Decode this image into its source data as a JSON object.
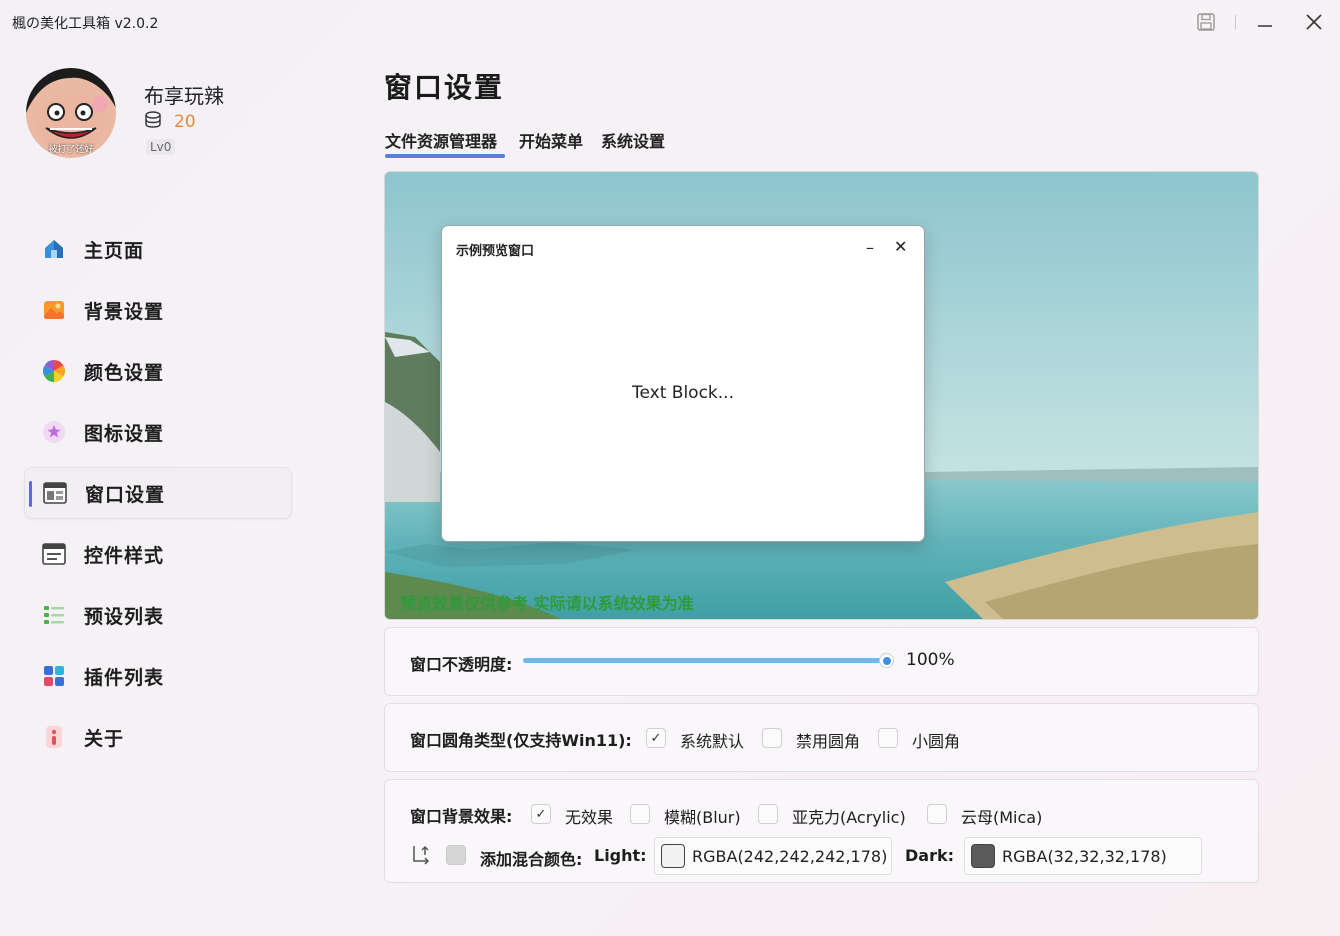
{
  "window": {
    "title": "楓の美化工具箱 v2.0.2"
  },
  "profile": {
    "name": "布享玩辣",
    "coins": "20",
    "level": "Lv0",
    "avatar_caption": "被打了还好"
  },
  "nav": [
    {
      "label": "主页面",
      "icon": "home-icon"
    },
    {
      "label": "背景设置",
      "icon": "picture-icon"
    },
    {
      "label": "颜色设置",
      "icon": "color-wheel-icon"
    },
    {
      "label": "图标设置",
      "icon": "star-icon"
    },
    {
      "label": "窗口设置",
      "icon": "window-icon",
      "active": true
    },
    {
      "label": "控件样式",
      "icon": "widget-icon"
    },
    {
      "label": "预设列表",
      "icon": "list-icon"
    },
    {
      "label": "插件列表",
      "icon": "apps-icon"
    },
    {
      "label": "关于",
      "icon": "info-icon"
    }
  ],
  "page": {
    "title": "窗口设置",
    "tabs": [
      "文件资源管理器",
      "开始菜单",
      "系统设置"
    ],
    "active_tab": 0
  },
  "preview": {
    "window_title": "示例预览窗口",
    "text_block": "Text Block...",
    "note": "预览效果仅供参考 实际请以系统效果为准"
  },
  "opacity": {
    "label": "窗口不透明度:",
    "value": 1.0,
    "value_text": "100%"
  },
  "corner": {
    "label": "窗口圆角类型(仅支持Win11):",
    "options": [
      {
        "label": "系统默认",
        "checked": true
      },
      {
        "label": "禁用圆角",
        "checked": false
      },
      {
        "label": "小圆角",
        "checked": false
      }
    ]
  },
  "backdrop": {
    "label": "窗口背景效果:",
    "options": [
      {
        "label": "无效果",
        "checked": true
      },
      {
        "label": "模糊(Blur)",
        "checked": false
      },
      {
        "label": "亚克力(Acrylic)",
        "checked": false
      },
      {
        "label": "云母(Mica)",
        "checked": false
      }
    ],
    "blend_label": "添加混合颜色:",
    "light_label": "Light:",
    "light_value": "RGBA(242,242,242,178)",
    "light_color": "#f2f2f2",
    "dark_label": "Dark:",
    "dark_value": "RGBA(32,32,32,178)",
    "dark_color": "#5a5a5a"
  },
  "colors": {
    "accent": "#5b7fd6",
    "slider": "#6fb9ee",
    "note_green": "#2f9a3a",
    "coins": "#e38a3b"
  }
}
